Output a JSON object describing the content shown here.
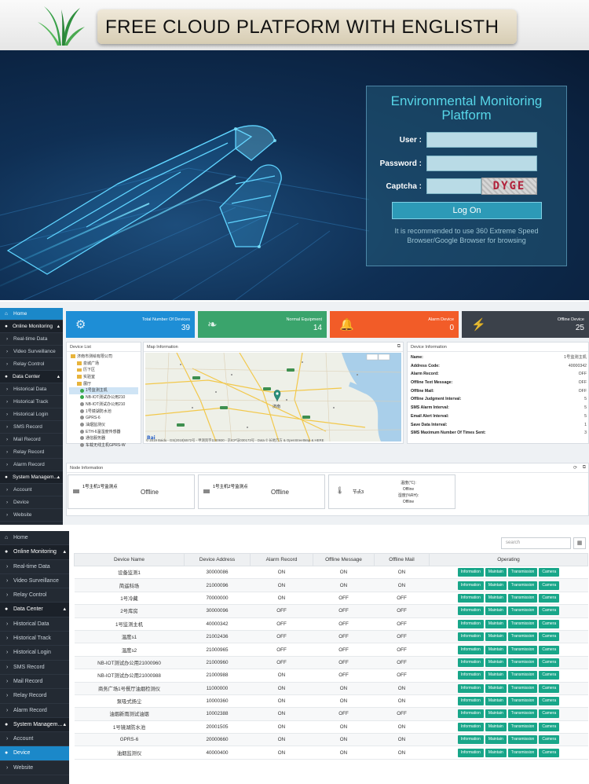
{
  "banner": {
    "title": "FREE CLOUD PLATFORM WITH ENGLISTH"
  },
  "login": {
    "title_line1": "Environmental Monitoring",
    "title_line2": "Platform",
    "user_label": "User :",
    "password_label": "Password :",
    "captcha_label": "Captcha :",
    "captcha_text": "DYGE",
    "logon_label": "Log On",
    "note": "It is recommended to use 360 Extreme Speed Browser/Google Browser for browsing"
  },
  "dashboard": {
    "sidebar": [
      {
        "label": "Home",
        "type": "active"
      },
      {
        "label": "Online Monitoring",
        "type": "header"
      },
      {
        "label": "Real-time Data",
        "type": "item"
      },
      {
        "label": "Video Surveillance",
        "type": "item"
      },
      {
        "label": "Relay Control",
        "type": "item"
      },
      {
        "label": "Data Center",
        "type": "header"
      },
      {
        "label": "Historical Data",
        "type": "item"
      },
      {
        "label": "Historical Track",
        "type": "item"
      },
      {
        "label": "Historical Login",
        "type": "item"
      },
      {
        "label": "SMS Record",
        "type": "item"
      },
      {
        "label": "Mail Record",
        "type": "item"
      },
      {
        "label": "Relay Record",
        "type": "item"
      },
      {
        "label": "Alarm Record",
        "type": "item"
      },
      {
        "label": "System Managem...",
        "type": "header"
      },
      {
        "label": "Account",
        "type": "item"
      },
      {
        "label": "Device",
        "type": "item"
      },
      {
        "label": "Website",
        "type": "item"
      }
    ],
    "stats": [
      {
        "label": "Total Number Of Devices",
        "value": "39",
        "color": "#1e8ed6",
        "icon": "gears-icon"
      },
      {
        "label": "Normal Equipment",
        "value": "14",
        "color": "#3aa46c",
        "icon": "leaf-icon"
      },
      {
        "label": "Alarm Device",
        "value": "0",
        "color": "#f25c28",
        "icon": "bell-icon"
      },
      {
        "label": "Offline Device",
        "value": "25",
        "color": "#3b414a",
        "icon": "plug-icon"
      }
    ],
    "device_list": {
      "title": "Device List",
      "items": [
        {
          "label": "济南市测绘有限公司",
          "kind": "folder"
        },
        {
          "label": "泉城广场",
          "kind": "folder"
        },
        {
          "label": "历下区",
          "kind": "folder"
        },
        {
          "label": "实验室",
          "kind": "folder"
        },
        {
          "label": "展厅",
          "kind": "folder"
        },
        {
          "label": "1号监测主机",
          "kind": "green"
        },
        {
          "label": "NB-IOT测试办公用210",
          "kind": "green"
        },
        {
          "label": "NB-IOT测试办公用210",
          "kind": "gray"
        },
        {
          "label": "1号镜湖防水池",
          "kind": "gray"
        },
        {
          "label": "GPRS-6",
          "kind": "gray"
        },
        {
          "label": "油烟监测仪",
          "kind": "gray"
        },
        {
          "label": "ETH-6温湿度传感器",
          "kind": "gray"
        },
        {
          "label": "通信服务器",
          "kind": "gray"
        },
        {
          "label": "车载无线主机GPRS-W",
          "kind": "gray"
        }
      ]
    },
    "map": {
      "title": "Map Information",
      "city": "济南",
      "copyright": "© 2019 Baidu - GS(2018)5572号 - 甲测资字1100930 - 京ICP证030173号 - Data © 长地万方 & OpenStreetMap & HERE"
    },
    "device_info": {
      "title": "Device Information",
      "rows": [
        {
          "label": "Name:",
          "value": "1号监测主机"
        },
        {
          "label": "Address Code:",
          "value": "40000342"
        },
        {
          "label": "Alarm Record:",
          "value": "OFF"
        },
        {
          "label": "Offline Text Message:",
          "value": "OFF"
        },
        {
          "label": "Offline Mail:",
          "value": "OFF"
        },
        {
          "label": "Offline Judgment Interval:",
          "value": "5"
        },
        {
          "label": "SMS Alarm Interval:",
          "value": "5"
        },
        {
          "label": "Email Alert Interval:",
          "value": "5"
        },
        {
          "label": "Save Data Interval:",
          "value": "1"
        },
        {
          "label": "SMS Maximum Number Of Times Sent:",
          "value": "3"
        }
      ]
    },
    "node_info": {
      "title": "Node Information",
      "cards": [
        {
          "name": "1号主机1号监测点",
          "status": "Offline"
        },
        {
          "name": "1号主机2号监测点",
          "status": "Offline"
        },
        {
          "name": "节点3",
          "line1": "温度(℃):",
          "line2": "Offline",
          "line3": "湿度(%RH):",
          "line4": "Offline"
        }
      ]
    }
  },
  "device_page": {
    "sidebar": [
      {
        "label": "Home",
        "type": "item-home"
      },
      {
        "label": "Online Monitoring",
        "type": "header"
      },
      {
        "label": "Real-time Data",
        "type": "item"
      },
      {
        "label": "Video Surveillance",
        "type": "item"
      },
      {
        "label": "Relay Control",
        "type": "item"
      },
      {
        "label": "Data Center",
        "type": "header"
      },
      {
        "label": "Historical Data",
        "type": "item"
      },
      {
        "label": "Historical Track",
        "type": "item"
      },
      {
        "label": "Historical Login",
        "type": "item"
      },
      {
        "label": "SMS Record",
        "type": "item"
      },
      {
        "label": "Mail Record",
        "type": "item"
      },
      {
        "label": "Relay Record",
        "type": "item"
      },
      {
        "label": "Alarm Record",
        "type": "item"
      },
      {
        "label": "System Managem...",
        "type": "header"
      },
      {
        "label": "Account",
        "type": "item"
      },
      {
        "label": "Device",
        "type": "active"
      },
      {
        "label": "Website",
        "type": "item"
      }
    ],
    "search_placeholder": "search",
    "columns": [
      "Device Name",
      "Device Address",
      "Alarm Record",
      "Offline Message",
      "Offline Mail",
      "Operating"
    ],
    "operations": [
      "Information",
      "Maintain",
      "Transmission",
      "Camera"
    ],
    "rows": [
      [
        "设备监测1",
        "30000086",
        "ON",
        "ON",
        "ON"
      ],
      [
        "简遥科场",
        "21000096",
        "ON",
        "ON",
        "ON"
      ],
      [
        "1号冷藏",
        "70000000",
        "ON",
        "OFF",
        "OFF"
      ],
      [
        "2号库房",
        "30000096",
        "OFF",
        "OFF",
        "OFF"
      ],
      [
        "1号监测主机",
        "40000342",
        "OFF",
        "OFF",
        "OFF"
      ],
      [
        "温度s1",
        "21002436",
        "OFF",
        "OFF",
        "OFF"
      ],
      [
        "温度s2",
        "21000965",
        "OFF",
        "OFF",
        "OFF"
      ],
      [
        "NB-IOT测试办公用21000960",
        "21000960",
        "OFF",
        "OFF",
        "OFF"
      ],
      [
        "NB-IOT测试办公用21000988",
        "21000988",
        "ON",
        "OFF",
        "OFF"
      ],
      [
        "商务广场1号餐厅油烟检测仪",
        "11000000",
        "ON",
        "ON",
        "ON"
      ],
      [
        "泵吸式扬尘",
        "10000360",
        "ON",
        "ON",
        "ON"
      ],
      [
        "油烟新雨测试油烟",
        "10002388",
        "ON",
        "OFF",
        "OFF"
      ],
      [
        "1号镜湖防水池",
        "20001505",
        "ON",
        "ON",
        "ON"
      ],
      [
        "GPRS-6",
        "20000660",
        "ON",
        "ON",
        "ON"
      ],
      [
        "油烟监测仪",
        "40000400",
        "ON",
        "ON",
        "ON"
      ]
    ]
  }
}
